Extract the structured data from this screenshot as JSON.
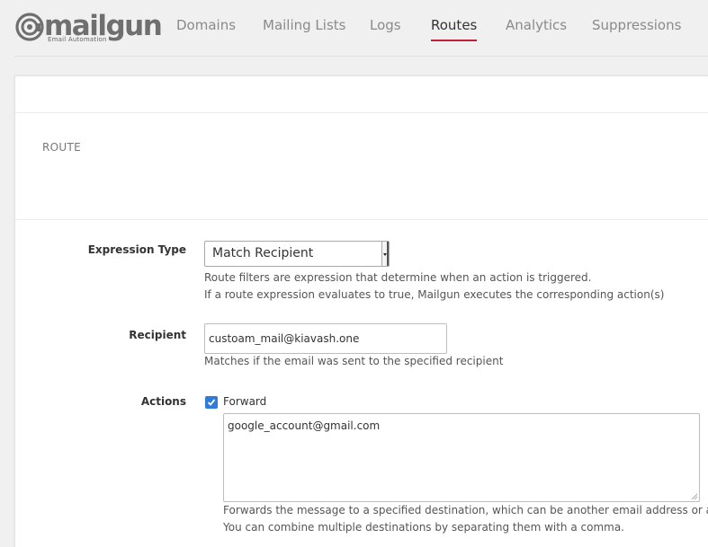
{
  "brand": {
    "name": "mailgun",
    "tagline": "Email Automation"
  },
  "nav": {
    "items": [
      {
        "label": "Domains"
      },
      {
        "label": "Mailing Lists"
      },
      {
        "label": "Logs"
      },
      {
        "label": "Routes",
        "active": true
      },
      {
        "label": "Analytics"
      },
      {
        "label": "Suppressions"
      }
    ]
  },
  "section": {
    "title": "ROUTE"
  },
  "form": {
    "expression_type": {
      "label": "Expression Type",
      "value": "Match Recipient",
      "help_line1": "Route filters are expression that determine when an action is triggered.",
      "help_line2": "If a route expression evaluates to true, Mailgun executes the corresponding action(s)"
    },
    "recipient": {
      "label": "Recipient",
      "value": "custoam_mail@kiavash.one",
      "help": "Matches if the email was sent to the specified recipient"
    },
    "actions": {
      "label": "Actions",
      "forward_label": "Forward",
      "forward_checked": true,
      "forward_value": "google_account@gmail.com",
      "help_line1": "Forwards the message to a specified destination, which can be another email address or a URL.",
      "help_line2": "You can combine multiple destinations by separating them with a comma."
    }
  },
  "colors": {
    "accent": "#c21e39",
    "checkbox": "#2f7bd9",
    "background": "#f0f0f0"
  }
}
